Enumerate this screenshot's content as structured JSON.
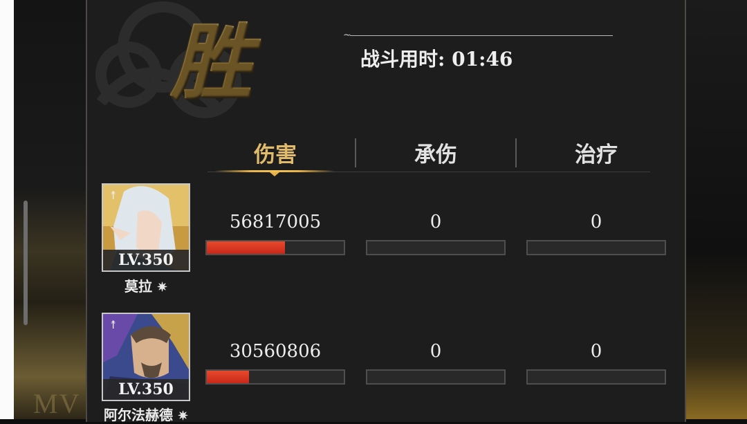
{
  "header": {
    "victory_char": "胜",
    "battle_time_label": "战斗用时",
    "battle_time_value": "01:46"
  },
  "tabs": [
    {
      "label": "伤害",
      "active": true
    },
    {
      "label": "承伤",
      "active": false
    },
    {
      "label": "治疗",
      "active": false
    }
  ],
  "heroes": [
    {
      "name": "莫拉",
      "level": "LV.350",
      "class_icon": "bow-icon",
      "damage": "56817005",
      "damage_fraction": 0.57,
      "damage_taken": "0",
      "taken_fraction": 0,
      "healing": "0",
      "healing_fraction": 0
    },
    {
      "name": "阿尔法赫德",
      "level": "LV.350",
      "class_icon": "bow-icon",
      "damage": "30560806",
      "damage_fraction": 0.31,
      "damage_taken": "0",
      "taken_fraction": 0,
      "healing": "0",
      "healing_fraction": 0
    }
  ],
  "background": {
    "mvp_ghost": "MV"
  },
  "colors": {
    "accent_gold": "#e0bb6a",
    "bar_red": "#d8321f",
    "panel": "#1d1d1d"
  }
}
